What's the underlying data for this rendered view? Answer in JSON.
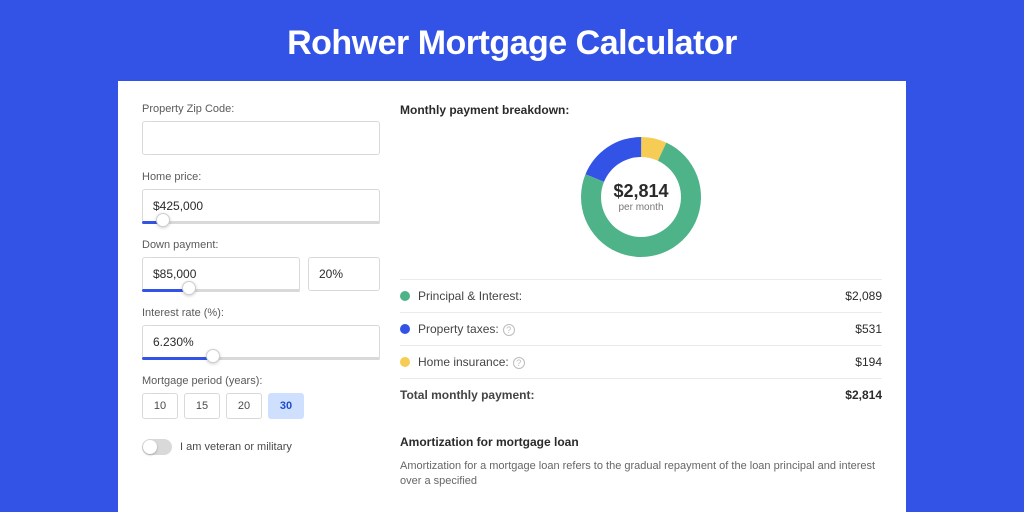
{
  "title": "Rohwer Mortgage Calculator",
  "colors": {
    "principal": "#4fb38a",
    "taxes": "#3253e6",
    "insurance": "#f6cc55"
  },
  "form": {
    "zip_label": "Property Zip Code:",
    "zip_value": "",
    "home_price_label": "Home price:",
    "home_price_value": "$425,000",
    "down_payment_label": "Down payment:",
    "down_payment_value": "$85,000",
    "down_payment_pct": "20%",
    "interest_label": "Interest rate (%):",
    "interest_value": "6.230%",
    "period_label": "Mortgage period (years):",
    "periods": [
      "10",
      "15",
      "20",
      "30"
    ],
    "period_active": "30",
    "veteran_label": "I am veteran or military"
  },
  "breakdown": {
    "title": "Monthly payment breakdown:",
    "center_value": "$2,814",
    "center_sub": "per month",
    "items": [
      {
        "label": "Principal & Interest:",
        "value": "$2,089",
        "color_key": "principal",
        "info": false
      },
      {
        "label": "Property taxes:",
        "value": "$531",
        "color_key": "taxes",
        "info": true
      },
      {
        "label": "Home insurance:",
        "value": "$194",
        "color_key": "insurance",
        "info": true
      }
    ],
    "total_label": "Total monthly payment:",
    "total_value": "$2,814"
  },
  "amortization": {
    "title": "Amortization for mortgage loan",
    "text": "Amortization for a mortgage loan refers to the gradual repayment of the loan principal and interest over a specified"
  },
  "chart_data": {
    "type": "pie",
    "title": "Monthly payment breakdown",
    "series": [
      {
        "name": "Principal & Interest",
        "value": 2089
      },
      {
        "name": "Property taxes",
        "value": 531
      },
      {
        "name": "Home insurance",
        "value": 194
      }
    ],
    "total": 2814,
    "unit": "USD per month"
  }
}
